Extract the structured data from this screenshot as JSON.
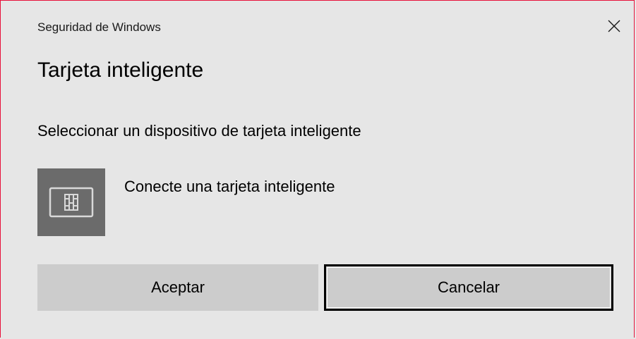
{
  "window": {
    "app_title": "Seguridad de Windows",
    "close_icon": "close-icon"
  },
  "dialog": {
    "heading": "Tarjeta inteligente",
    "subheading": "Seleccionar un dispositivo de tarjeta inteligente",
    "device": {
      "icon": "smart-card-icon",
      "label": "Conecte una tarjeta inteligente"
    },
    "buttons": {
      "accept_label": "Aceptar",
      "cancel_label": "Cancelar"
    }
  },
  "colors": {
    "background": "#e6e6e6",
    "accent_border": "#e8113a",
    "tile": "#6b6b6b",
    "button": "#cccccc"
  }
}
